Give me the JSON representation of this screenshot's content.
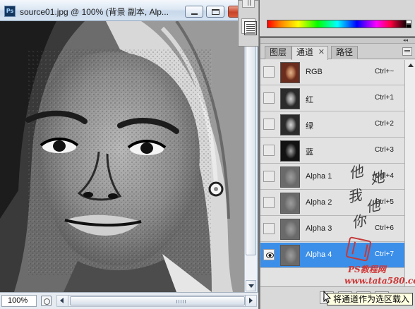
{
  "document": {
    "title": "source01.jpg @ 100% (背景 副本, Alp...",
    "app_icon": "Ps",
    "zoom": "100%",
    "close_glyph": "✕"
  },
  "channels_panel": {
    "tabs": [
      {
        "label": "图层",
        "active": false
      },
      {
        "label": "通道",
        "active": true,
        "close": "✕"
      },
      {
        "label": "路径",
        "active": false
      }
    ],
    "channels": [
      {
        "name": "RGB",
        "shortcut": "Ctrl+~",
        "visible": false,
        "selected": false,
        "thumb": "color"
      },
      {
        "name": "红",
        "shortcut": "Ctrl+1",
        "visible": false,
        "selected": false,
        "thumb": "gray"
      },
      {
        "name": "绿",
        "shortcut": "Ctrl+2",
        "visible": false,
        "selected": false,
        "thumb": "gray"
      },
      {
        "name": "蓝",
        "shortcut": "Ctrl+3",
        "visible": false,
        "selected": false,
        "thumb": "dark"
      },
      {
        "name": "Alpha 1",
        "shortcut": "Ctrl+4",
        "visible": false,
        "selected": false,
        "thumb": "alpha"
      },
      {
        "name": "Alpha 2",
        "shortcut": "Ctrl+5",
        "visible": false,
        "selected": false,
        "thumb": "alpha"
      },
      {
        "name": "Alpha 3",
        "shortcut": "Ctrl+6",
        "visible": false,
        "selected": false,
        "thumb": "alpha"
      },
      {
        "name": "Alpha 4",
        "shortcut": "Ctrl+7",
        "visible": true,
        "selected": true,
        "thumb": "alpha"
      }
    ],
    "tooltip": "将通道作为选区载入",
    "selection_color": "#3b8fe8"
  },
  "watermark": {
    "signature": [
      "他",
      "她",
      "我",
      "他",
      "你"
    ],
    "line1": "PS教程网",
    "line2": "www.tata580.com"
  },
  "icons": {
    "eye": "eye-icon",
    "menu": "panel-menu-icon",
    "load_selection": "dotted-circle-icon",
    "save_selection": "save-selection-icon",
    "new_channel": "new-channel-icon",
    "delete_channel": "trash-icon"
  }
}
